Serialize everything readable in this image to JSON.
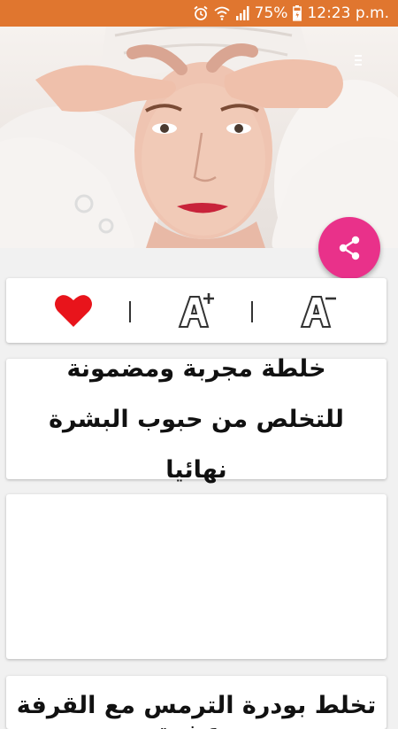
{
  "status_bar": {
    "battery": "75%",
    "time": "12:23 p.m.",
    "bg_color": "#e0762f",
    "icons": [
      "alarm-icon",
      "wifi-icon",
      "signal-icon",
      "battery-icon"
    ]
  },
  "hero": {
    "image": "woman-in-white-bathrobe-touching-forehead"
  },
  "fab": {
    "icon": "share-icon",
    "color": "#e9318a"
  },
  "toolbar": {
    "favorite_icon": "heart-icon",
    "favorite_color": "#e8141b",
    "font_increase_icon": "font-increase-icon",
    "font_decrease_icon": "font-decrease-icon"
  },
  "article": {
    "title": "خلطة مجربة ومضمونة للتخلص من حبوب البشرة نهائيا"
  },
  "next_article": {
    "title": "تخلط بودرة الترمس مع القرفة وعشبة"
  }
}
